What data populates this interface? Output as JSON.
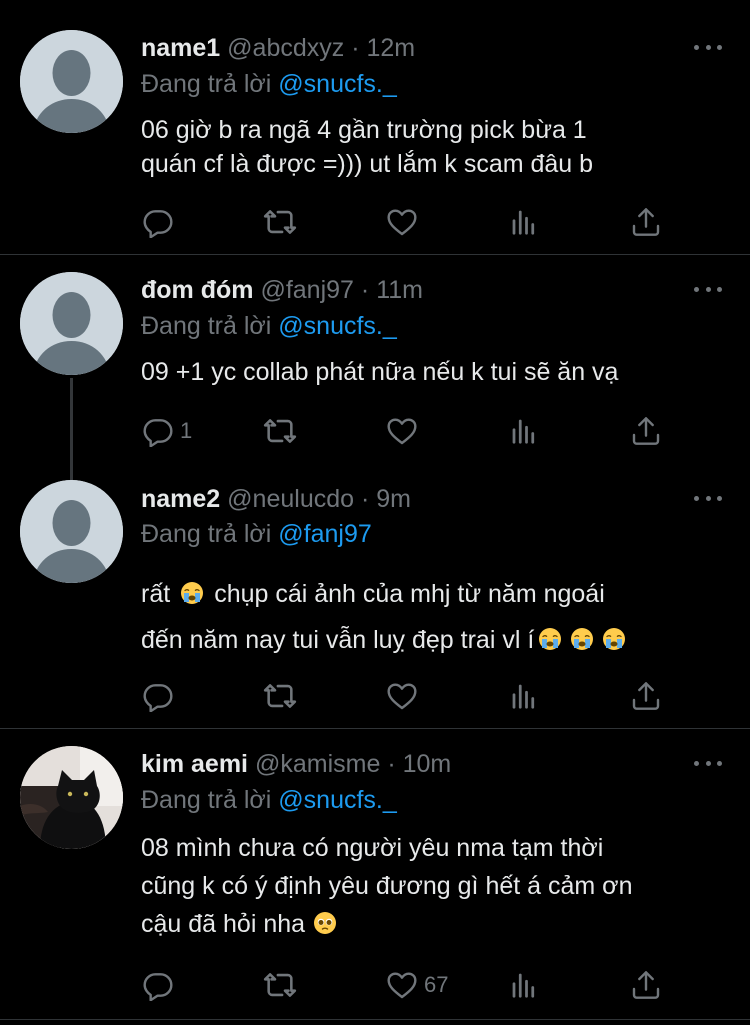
{
  "tweets": [
    {
      "name": "name1",
      "handle": "@abcdxyz",
      "time": "12m",
      "replying_label": "Đang trả lời",
      "replying_to": "@snucfs._",
      "text_line1": "06 giờ b ra ngã 4 gần trường pick bừa 1",
      "text_line2": "quán cf là được =))) ut lắm k scam đâu b",
      "reply_count": "",
      "like_count": ""
    },
    {
      "name": "đom đóm",
      "handle": "@fanj97",
      "time": "11m",
      "replying_label": "Đang trả lời",
      "replying_to": "@snucfs._",
      "text_line1": "09 +1 yc collab phát nữa nếu k tui sẽ ăn vạ",
      "reply_count": "1",
      "like_count": ""
    },
    {
      "name": "name2",
      "handle": "@neulucdo",
      "time": "9m",
      "replying_label": "Đang trả lời",
      "replying_to": "@fanj97",
      "text_line1_a": "rất",
      "text_line1_b": "chụp cái ảnh của mhj từ năm ngoái",
      "text_line2": "đến năm nay tui vẫn luỵ đẹp trai vl í",
      "reply_count": "",
      "like_count": ""
    },
    {
      "name": "kim aemi",
      "handle": "@kamisme",
      "time": "10m",
      "replying_label": "Đang trả lời",
      "replying_to": "@snucfs._",
      "text_line1": "08 mình chưa có người yêu nma tạm thời",
      "text_line2": "cũng k có ý định yêu đương gì hết á cảm ơn",
      "text_line3": "cậu đã hỏi nha",
      "reply_count": "",
      "like_count": "67"
    }
  ],
  "separator": "·",
  "colors": {
    "background": "#000000",
    "text": "#e7e9ea",
    "muted": "#71767b",
    "mention": "#1d9bf0",
    "divider": "#2f3336"
  },
  "icons": [
    "reply-icon",
    "retweet-icon",
    "like-icon",
    "analytics-icon",
    "share-icon",
    "more-icon",
    "crying-emoji",
    "pleading-emoji"
  ]
}
